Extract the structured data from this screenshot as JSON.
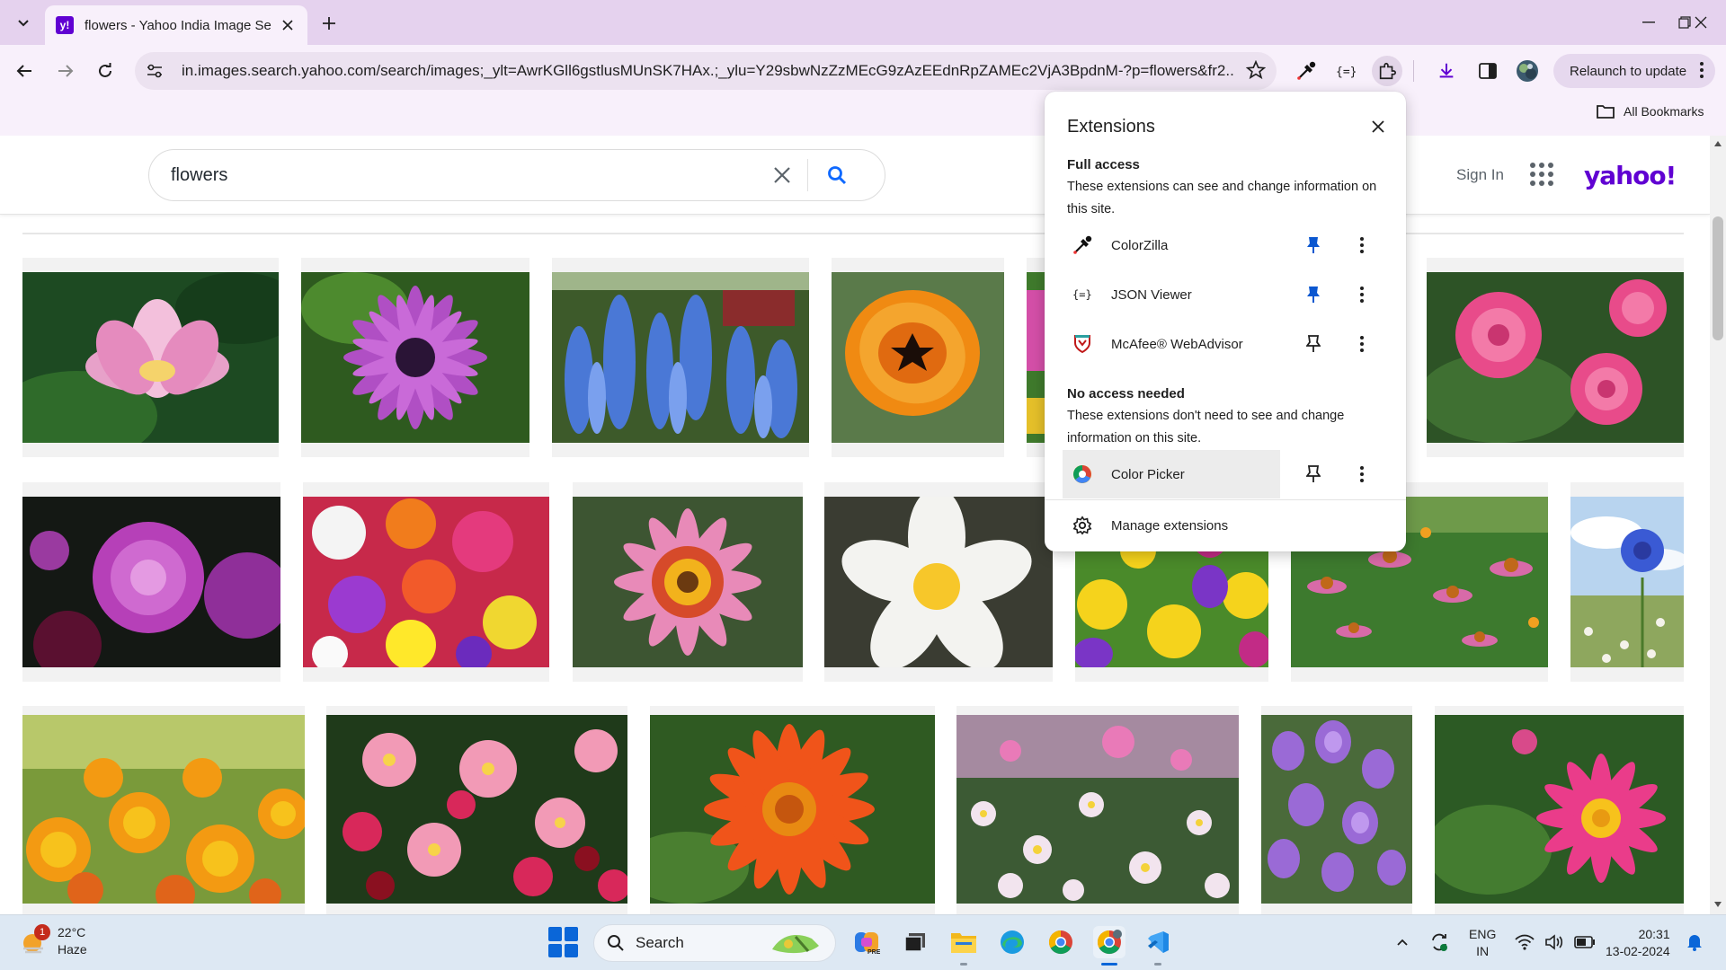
{
  "browser": {
    "tab": {
      "title": "flowers - Yahoo India Image Se",
      "favicon": "y!"
    },
    "url": "in.images.search.yahoo.com/search/images;_ylt=AwrKGll6gstlusMUnSK7HAx.;_ylu=Y29sbwNzZzMEcG9zAzEEdnRpZAMEc2VjA3BpdnM-?p=flowers&fr2...",
    "relaunch_label": "Relaunch to update",
    "all_bookmarks_label": "All Bookmarks"
  },
  "yahoo": {
    "search_query": "flowers",
    "sign_in": "Sign In",
    "logo": "yahoo!"
  },
  "extensions_popup": {
    "title": "Extensions",
    "full_access": {
      "heading": "Full access",
      "description": "These extensions can see and change information on this site.",
      "items": [
        {
          "name": "ColorZilla",
          "icon": "eyedropper-icon",
          "pinned": true
        },
        {
          "name": "JSON Viewer",
          "icon": "json-braces-icon",
          "pinned": true
        },
        {
          "name": "McAfee® WebAdvisor",
          "icon": "mcafee-shield-icon",
          "pinned": false
        }
      ]
    },
    "no_access": {
      "heading": "No access needed",
      "description": "These extensions don't need to see and change information on this site.",
      "items": [
        {
          "name": "Color Picker",
          "icon": "color-wheel-icon",
          "pinned": false
        }
      ]
    },
    "manage_label": "Manage extensions"
  },
  "images": {
    "row1": [
      "pink lotus",
      "purple daisy",
      "blue delphinium",
      "orange tulip",
      "pink flower",
      "pink roses"
    ],
    "row2": [
      "purple dahlias",
      "mixed bouquet",
      "pink gazania",
      "white plumeria",
      "tulips and daffodils",
      "coneflower field",
      "blue cornflower"
    ],
    "row3": [
      "marigolds",
      "pink cosmos",
      "orange gerbera",
      "daisy meadow",
      "purple bellflowers",
      "pink dahlia"
    ]
  },
  "taskbar": {
    "weather": {
      "temp": "22°C",
      "condition": "Haze",
      "badge": "1"
    },
    "search_label": "Search",
    "language": [
      "ENG",
      "IN"
    ],
    "time": "20:31",
    "date": "13-02-2024"
  },
  "colors": {
    "yahoo_purple": "#6001d2",
    "pin_blue": "#0b57d0",
    "chrome_frame": "#e5d2ee"
  }
}
